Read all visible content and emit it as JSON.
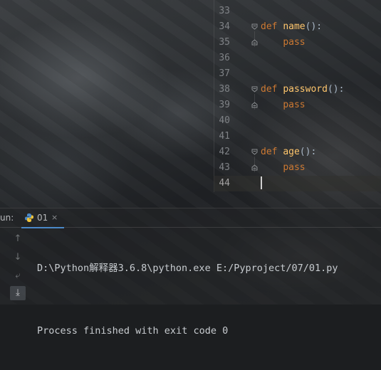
{
  "editor": {
    "lines": [
      {
        "num": "33"
      },
      {
        "num": "34",
        "kw": "def",
        "fn": "name",
        "rest": "():"
      },
      {
        "num": "35",
        "indent": "    ",
        "kw": "pass"
      },
      {
        "num": "36"
      },
      {
        "num": "37"
      },
      {
        "num": "38",
        "kw": "def",
        "fn": "password",
        "rest": "():"
      },
      {
        "num": "39",
        "indent": "    ",
        "kw": "pass"
      },
      {
        "num": "40"
      },
      {
        "num": "41"
      },
      {
        "num": "42",
        "kw": "def",
        "fn": "age",
        "rest": "():"
      },
      {
        "num": "43",
        "indent": "    ",
        "kw": "pass"
      },
      {
        "num": "44"
      }
    ]
  },
  "run_panel": {
    "label": "un:",
    "tab_label": "01",
    "tab_close": "×",
    "console_lines": [
      "D:\\Python解释器3.6.8\\python.exe E:/Pyproject/07/01.py",
      "Process finished with exit code 0"
    ],
    "tools": [
      {
        "icon": "arrow-up-icon",
        "glyph": "↑"
      },
      {
        "icon": "arrow-down-icon",
        "glyph": "↓"
      },
      {
        "icon": "soft-wrap-icon",
        "glyph": "⤶"
      },
      {
        "icon": "scroll-to-end-icon",
        "glyph": "⤓"
      }
    ]
  },
  "colors": {
    "keyword": "#cc7832",
    "function": "#ffc66d",
    "line_number": "#7f8286",
    "tab_underline": "#4a88c7"
  }
}
